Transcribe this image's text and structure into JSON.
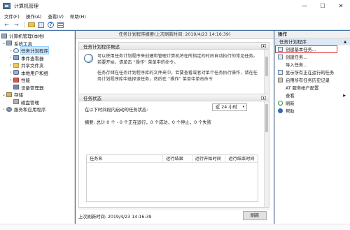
{
  "window": {
    "title": "计算机管理",
    "minimize": "—",
    "maximize": "☐",
    "close": "✕"
  },
  "menu": [
    "文件(F)",
    "操作(A)",
    "查看(V)",
    "帮助(H)"
  ],
  "tree": {
    "items": [
      {
        "label": "计算机管理(本地)",
        "expander": "",
        "icon": "computer-mgmt-icon"
      },
      {
        "label": "系统工具",
        "expander": "⌄",
        "icon": "tools-icon"
      },
      {
        "label": "任务计划程序",
        "expander": "›",
        "icon": "task-scheduler-icon",
        "selected": true
      },
      {
        "label": "事件查看器",
        "expander": "›",
        "icon": "event-viewer-icon"
      },
      {
        "label": "共享文件夹",
        "expander": "›",
        "icon": "shared-folders-icon"
      },
      {
        "label": "本地用户和组",
        "expander": "›",
        "icon": "users-icon"
      },
      {
        "label": "性能",
        "expander": "›",
        "icon": "performance-icon"
      },
      {
        "label": "设备管理器",
        "expander": "",
        "icon": "device-manager-icon"
      },
      {
        "label": "存储",
        "expander": "⌄",
        "icon": "storage-icon"
      },
      {
        "label": "磁盘管理",
        "expander": "",
        "icon": "disk-management-icon"
      },
      {
        "label": "服务和应用程序",
        "expander": "›",
        "icon": "services-icon"
      }
    ]
  },
  "center": {
    "header": "任务计划程序摘要(上次刷新时间: 2019/4/23 14:16:39)",
    "overview": {
      "title": "任务计划程序概述",
      "para1": "可以使用任务计划程序来创建和管理计算机将在所指定的时间自动执行的常见任务。若要开始，请单击 “操作” 菜单中的命令。",
      "para2": "任务存储在任务计划程序库的文件夹中。若要查看或者对单个任务执行操作，请在任务计划程序库中选择该任务，然后在 “操作” 菜单中单击命令"
    },
    "status": {
      "title": "任务状态",
      "prompt": "在以下时间段内启动的任务状态:",
      "period": "近 24 小时",
      "summary": "摘要: 总计 0 个 - 0 个正在运行，0 个成功，0 个停止，0 个失败",
      "columns": [
        "任务名",
        "运行结果",
        "运行开始时间",
        "运行结束时间"
      ]
    },
    "footer": {
      "last_refresh": "上次刷新时间: 2019/4/23 14:16:39",
      "refresh_button": "刷新"
    }
  },
  "actions": {
    "title": "操作",
    "section": "任务计划程序",
    "items": [
      {
        "label": "创建基本任务...",
        "icon": "create-basic-task-icon",
        "highlighted": true
      },
      {
        "label": "创建任务...",
        "icon": "create-task-icon"
      },
      {
        "label": "导入任务...",
        "icon": "none"
      },
      {
        "label": "显示所有正在运行的任务",
        "icon": "running-tasks-icon"
      },
      {
        "label": "启用所有任务历史记录",
        "icon": "history-icon"
      },
      {
        "label": "AT 服务帐户配置",
        "icon": "none"
      },
      {
        "label": "查看",
        "icon": "none",
        "submenu": true
      },
      {
        "label": "刷新",
        "icon": "refresh-icon"
      },
      {
        "label": "帮助",
        "icon": "help-icon"
      }
    ]
  }
}
